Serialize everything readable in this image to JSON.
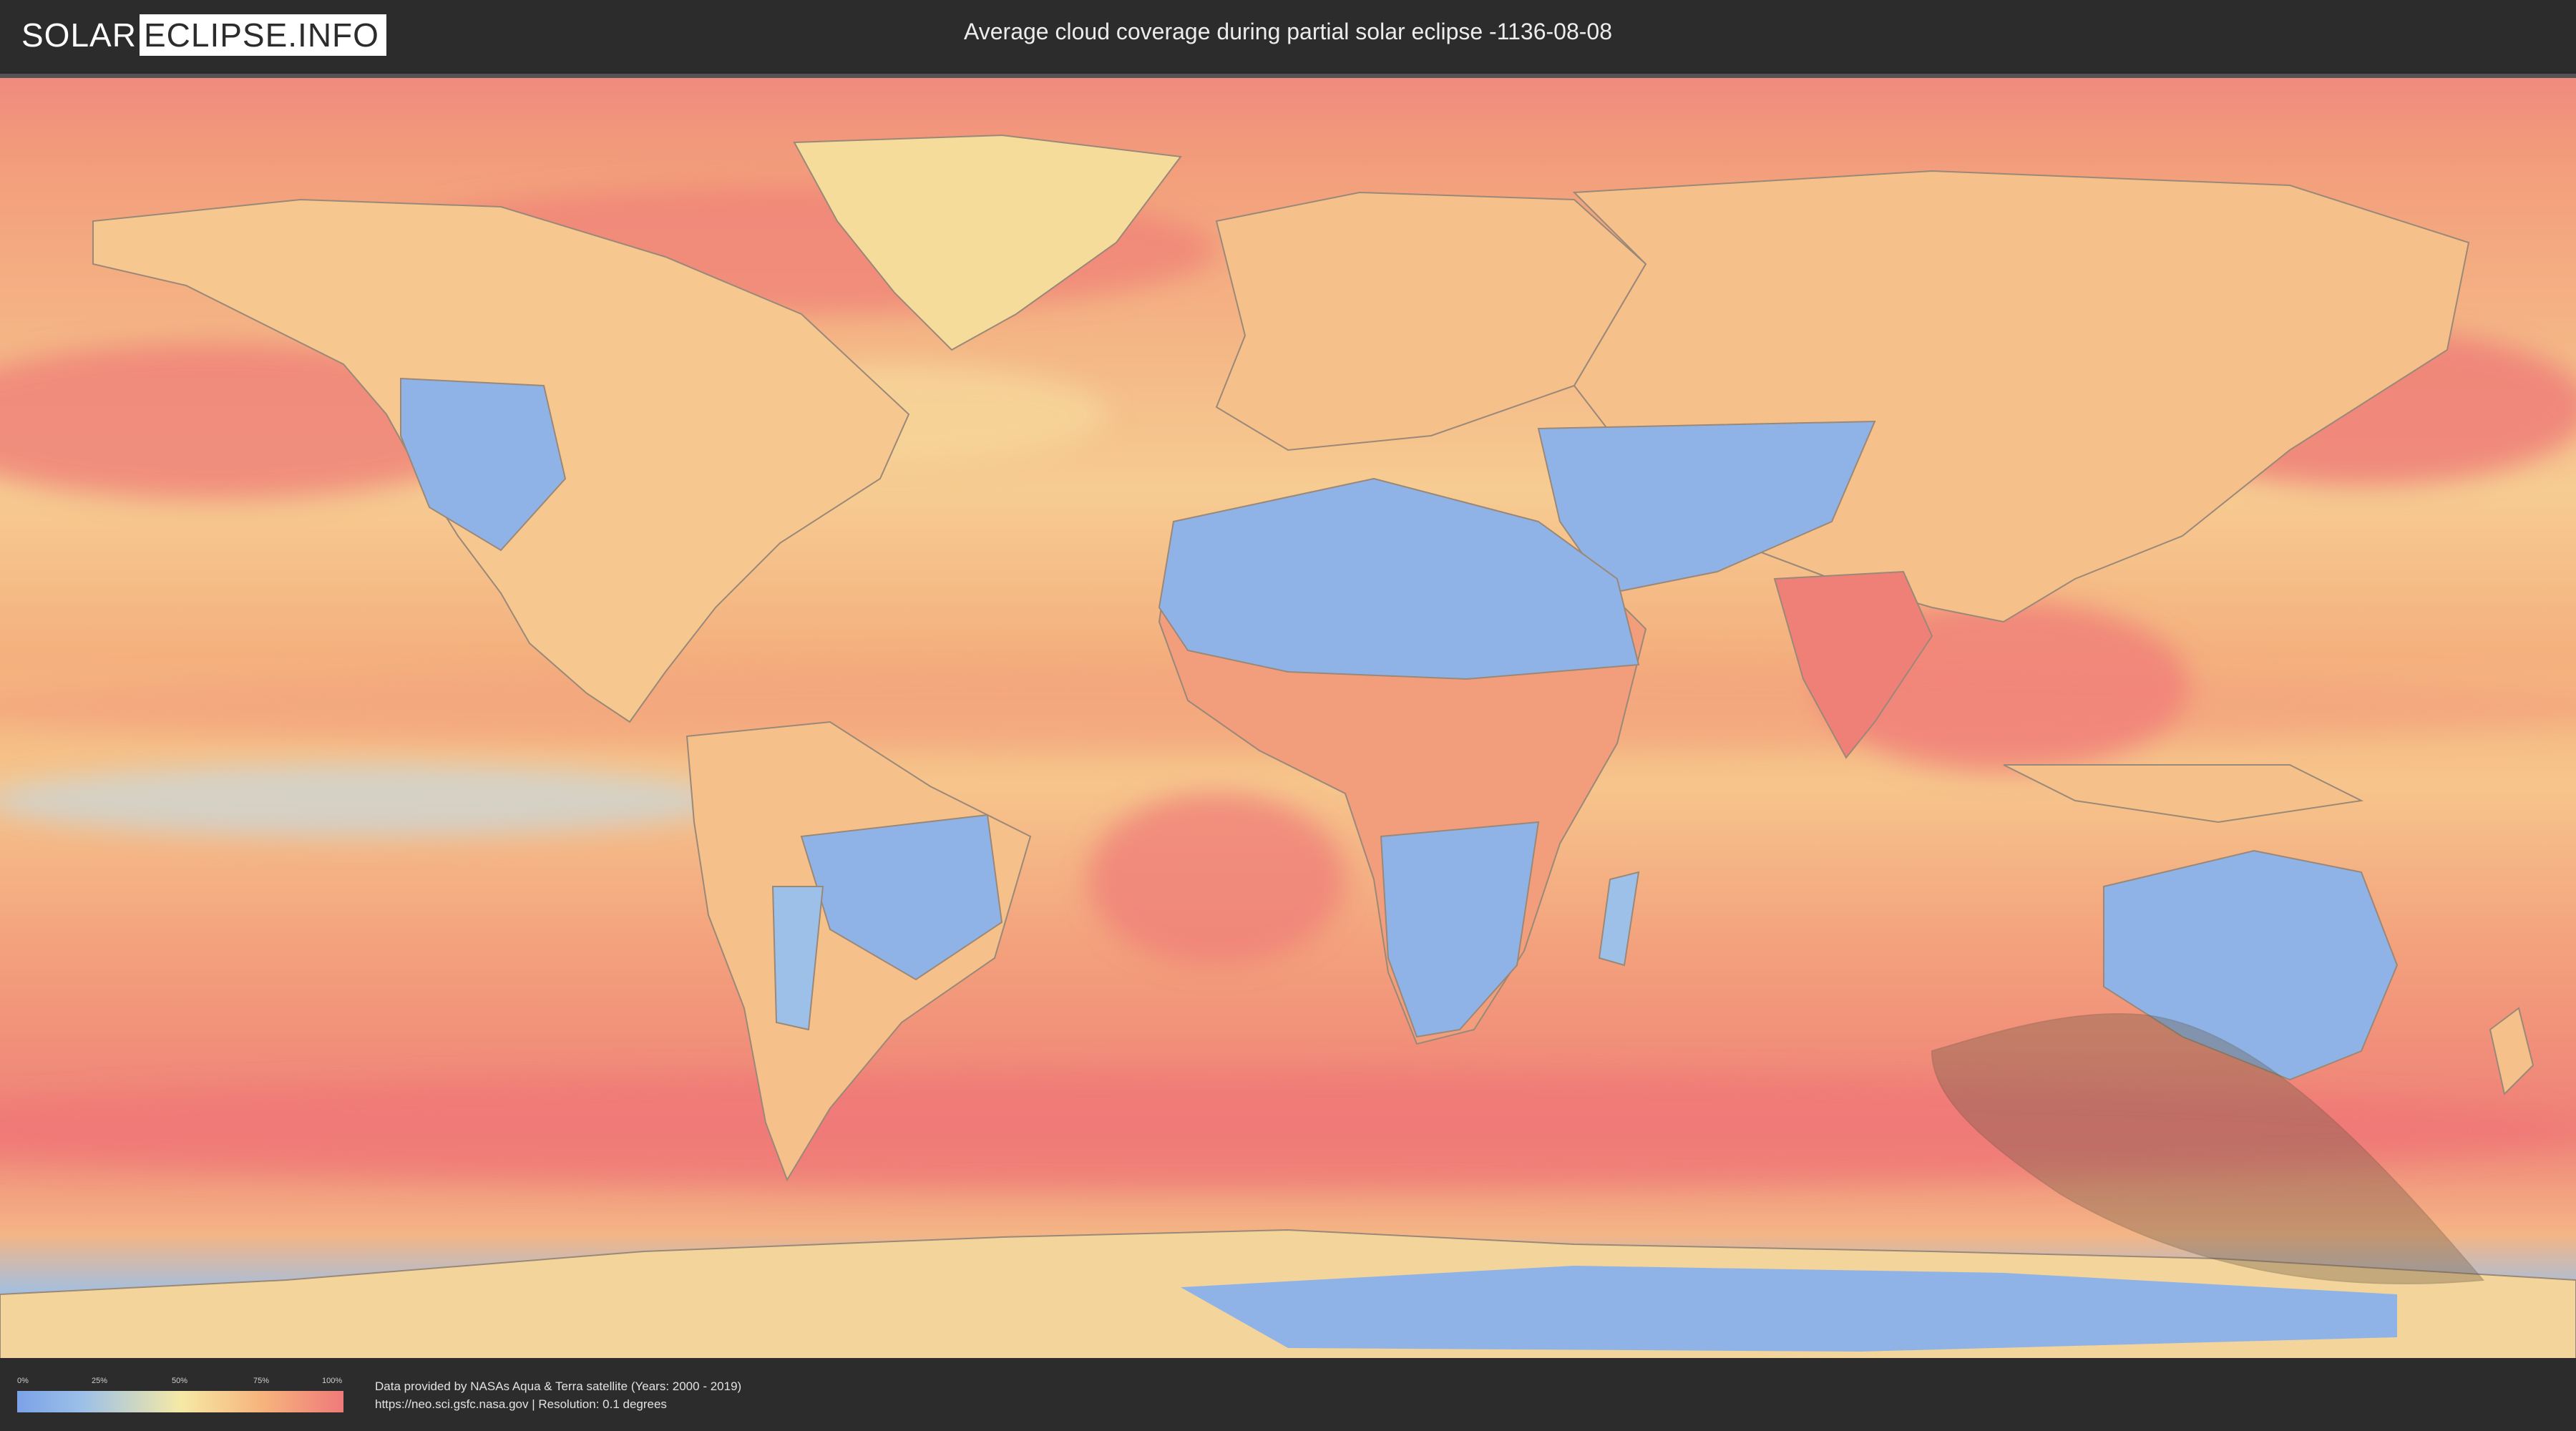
{
  "header": {
    "logo_left": "SOLAR",
    "logo_right": "ECLIPSE.INFO",
    "title": "Average cloud coverage during partial solar eclipse -1136-08-08"
  },
  "map": {
    "icon": "world-cloud-coverage-map",
    "colors": {
      "clear": "#7ba2e8",
      "low": "#9cc0e8",
      "mid": "#f5e9a6",
      "high": "#f6b47c",
      "full": "#ef7a7a",
      "eclipse_shadow": "#6b5a45"
    }
  },
  "legend": {
    "ticks": [
      "0%",
      "25%",
      "50%",
      "75%",
      "100%"
    ]
  },
  "footer": {
    "line1": "Data provided by NASAs Aqua & Terra satellite (Years: 2000 - 2019)",
    "line2": "https://neo.sci.gsfc.nasa.gov | Resolution: 0.1 degrees"
  }
}
